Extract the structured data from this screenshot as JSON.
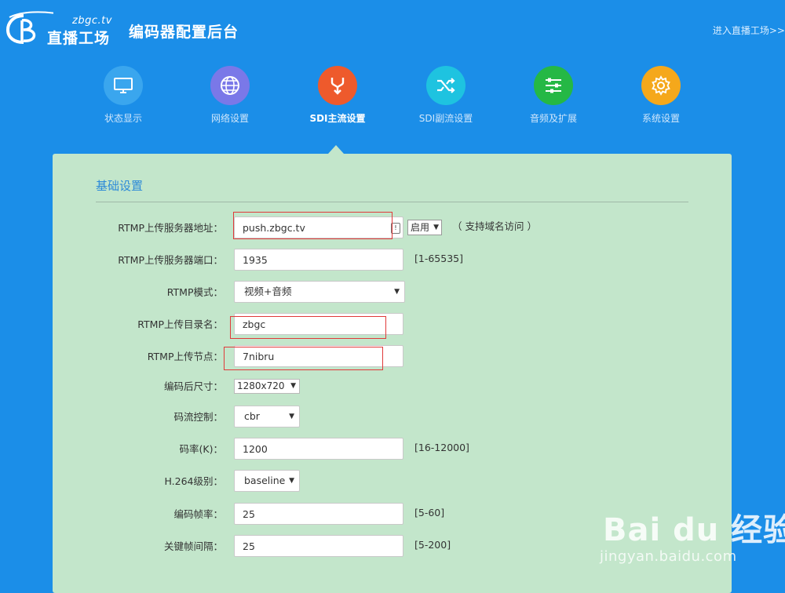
{
  "header": {
    "logo_domain": "zbgc.tv",
    "logo_brand": "直播工场",
    "site_title": "编码器配置后台",
    "enter_link": "进入直播工场>>"
  },
  "nav": {
    "items": [
      {
        "label": "状态显示",
        "icon": "monitor-icon",
        "color": "#3aa6ee"
      },
      {
        "label": "网络设置",
        "icon": "globe-icon",
        "color": "#7a78e8"
      },
      {
        "label": "SDI主流设置",
        "icon": "fork-arrow-icon",
        "color": "#ee5a2c",
        "active": true
      },
      {
        "label": "SDI副流设置",
        "icon": "shuffle-icon",
        "color": "#1ec3e0"
      },
      {
        "label": "音频及扩展",
        "icon": "sliders-icon",
        "color": "#25b845"
      },
      {
        "label": "系统设置",
        "icon": "gear-icon",
        "color": "#f5a81b"
      }
    ]
  },
  "section": {
    "title": "基础设置"
  },
  "form": {
    "server_address": {
      "label": "RTMP上传服务器地址：",
      "value": "push.zbgc.tv",
      "toggle": "启用",
      "hint": "（ 支持域名访问 ）"
    },
    "server_port": {
      "label": "RTMP上传服务器端口：",
      "value": "1935",
      "hint": "[1-65535]"
    },
    "mode": {
      "label": "RTMP模式：",
      "value": "视频+音频"
    },
    "directory": {
      "label": "RTMP上传目录名：",
      "value": "zbgc"
    },
    "node": {
      "label": "RTMP上传节点：",
      "value": "7nibru"
    },
    "encoded_size": {
      "label": "编码后尺寸：",
      "value": "1280x720"
    },
    "rate_control": {
      "label": "码流控制：",
      "value": "cbr"
    },
    "bitrate": {
      "label": "码率(K)：",
      "value": "1200",
      "hint": "[16-12000]"
    },
    "h264_level": {
      "label": "H.264级别：",
      "value": "baseline"
    },
    "framerate": {
      "label": "编码帧率：",
      "value": "25",
      "hint": "[5-60]"
    },
    "keyframe_interval": {
      "label": "关键帧间隔：",
      "value": "25",
      "hint": "[5-200]"
    }
  },
  "watermark": {
    "logo": "Bai du 经验",
    "url": "jingyan.baidu.com"
  },
  "colors": {
    "background": "#1b8ee8",
    "panel": "#c3e6cb",
    "accent": "#2d8ad8",
    "highlight": "#e03a3a"
  }
}
